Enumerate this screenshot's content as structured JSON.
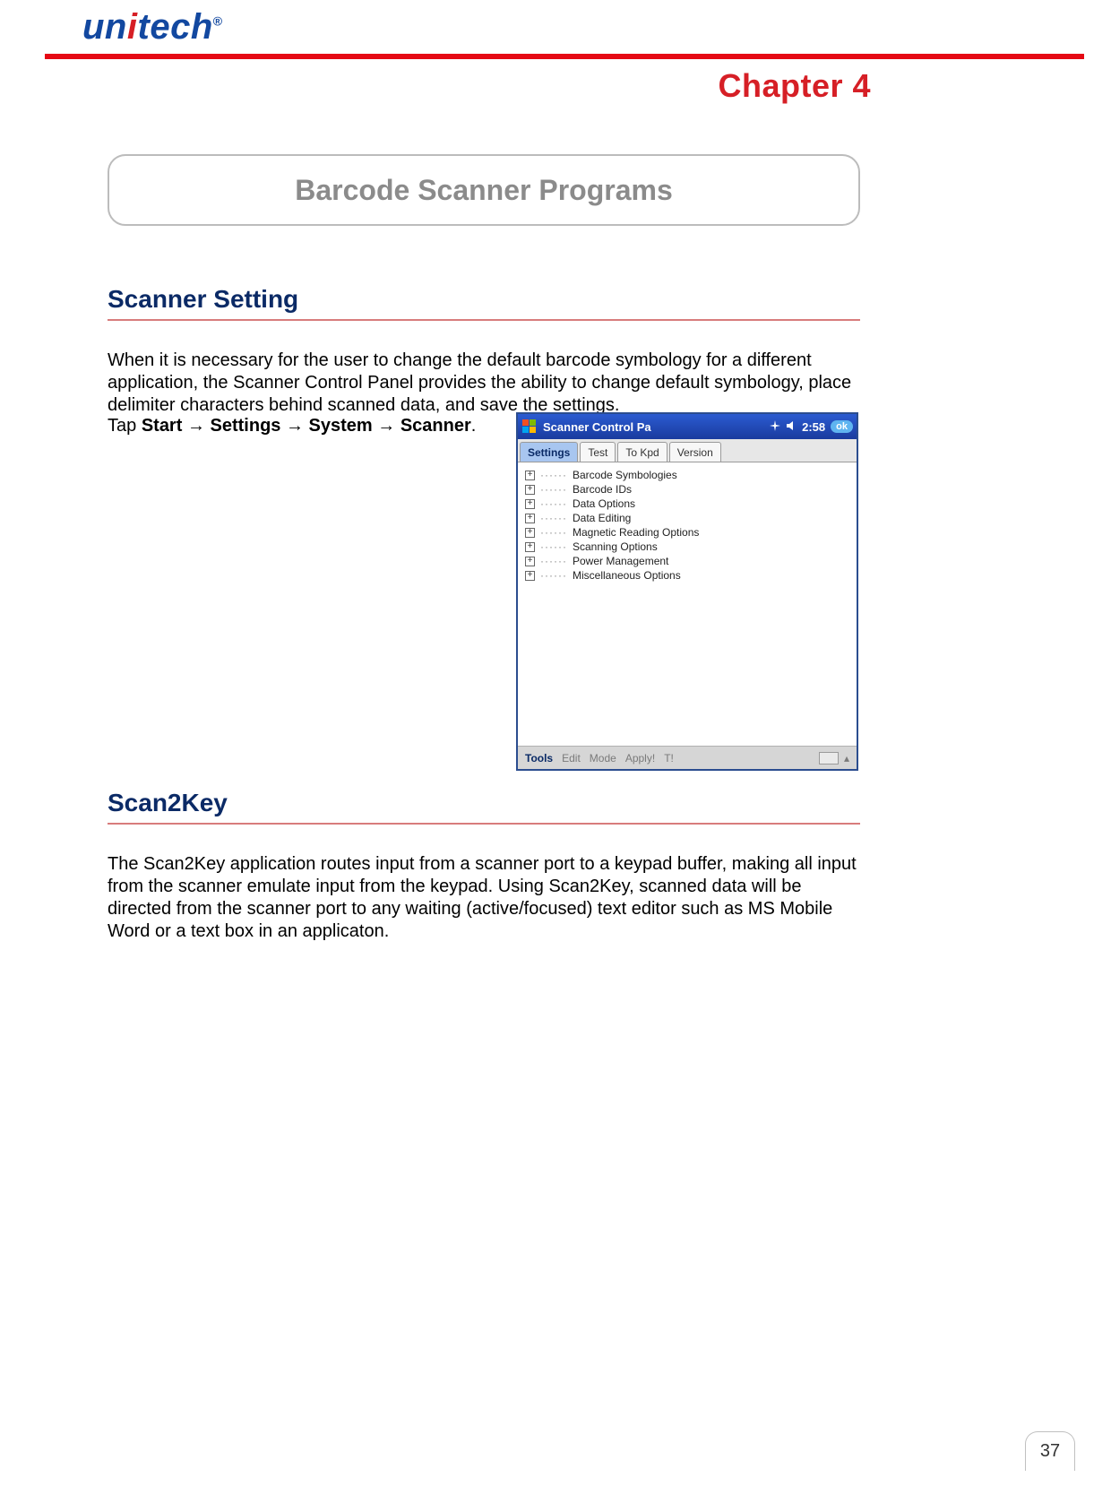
{
  "brand": {
    "pre": "un",
    "i": "i",
    "post": "tech",
    "reg": "®"
  },
  "chapter": "Chapter  4",
  "panel_title": "Barcode Scanner Programs",
  "section1": {
    "heading": "Scanner Setting",
    "body": "When it is necessary for the user to change the default barcode symbology for a different application, the Scanner Control Panel provides the ability to change default symbology, place delimiter characters behind scanned data, and save the settings.",
    "tap_prefix": "Tap ",
    "tap_parts": [
      "Start",
      "Settings",
      "System",
      "Scanner"
    ],
    "arrow": " → "
  },
  "screenshot": {
    "title": "Scanner Control Pa",
    "time": "2:58",
    "ok": "ok",
    "tabs": [
      "Settings",
      "Test",
      "To Kpd",
      "Version"
    ],
    "tree": [
      "Barcode Symbologies",
      "Barcode IDs",
      "Data Options",
      "Data Editing",
      "Magnetic Reading Options",
      "Scanning Options",
      "Power Management",
      "Miscellaneous Options"
    ],
    "menu": [
      "Tools",
      "Edit",
      "Mode",
      "Apply!",
      "T!"
    ]
  },
  "section2": {
    "heading": "Scan2Key",
    "body": "The Scan2Key application routes input from a scanner port to a keypad buffer, making all input from the scanner emulate input from the keypad. Using Scan2Key, scanned data will be directed from the scanner port to any waiting (active/focused) text editor such as MS Mobile Word or a text box in an applicaton."
  },
  "page_number": "37"
}
